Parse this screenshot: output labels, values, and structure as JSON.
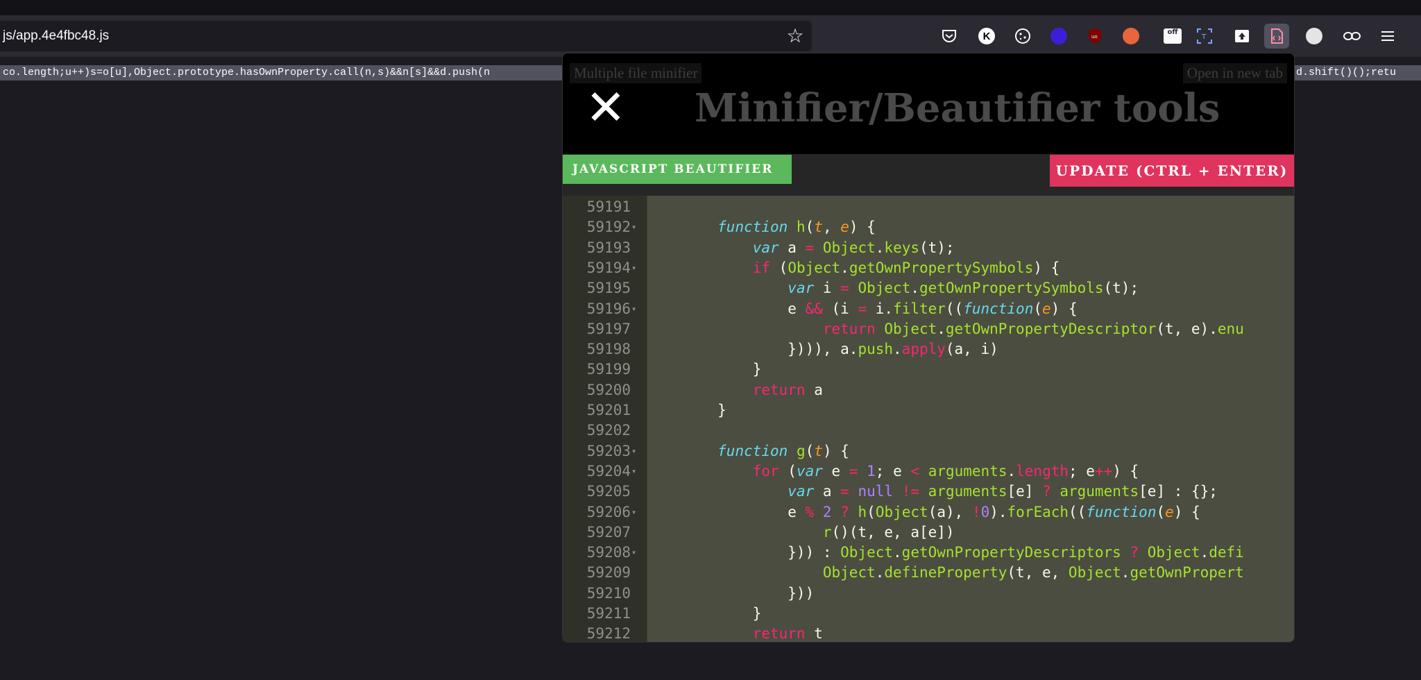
{
  "browser": {
    "url": "js/app.4e4fbc48.js",
    "minified_text_left": "co.length;u++)s=o[u],Object.prototype.hasOwnProperty.call(n,s)&&n[s]&&d.push(n",
    "minified_text_right": "d.shift()();retu",
    "star_icon": "star-icon"
  },
  "extensions": [
    "pocket-icon",
    "k-icon",
    "cookie-icon",
    "circle-icon",
    "ublock-icon",
    "fox-icon",
    "off-icon",
    "scan-icon",
    "upload-icon",
    "minifier-icon",
    "ball-icon",
    "eyes-icon",
    "menu-icon"
  ],
  "panel": {
    "link_left": "Multiple file minifier",
    "link_right": "Open in new tab",
    "close_symbol": "✕",
    "title": "Minifier/Beautifier tools",
    "mode_button": "JAVASCRIPT BEAUTIFIER",
    "update_button": "UPDATE (CTRL + ENTER)"
  },
  "editor": {
    "lines": [
      {
        "n": "59191",
        "fold": false
      },
      {
        "n": "59192",
        "fold": true
      },
      {
        "n": "59193",
        "fold": false
      },
      {
        "n": "59194",
        "fold": true
      },
      {
        "n": "59195",
        "fold": false
      },
      {
        "n": "59196",
        "fold": true
      },
      {
        "n": "59197",
        "fold": false
      },
      {
        "n": "59198",
        "fold": false
      },
      {
        "n": "59199",
        "fold": false
      },
      {
        "n": "59200",
        "fold": false
      },
      {
        "n": "59201",
        "fold": false
      },
      {
        "n": "59202",
        "fold": false
      },
      {
        "n": "59203",
        "fold": true
      },
      {
        "n": "59204",
        "fold": true
      },
      {
        "n": "59205",
        "fold": false
      },
      {
        "n": "59206",
        "fold": true
      },
      {
        "n": "59207",
        "fold": false
      },
      {
        "n": "59208",
        "fold": true
      },
      {
        "n": "59209",
        "fold": false
      },
      {
        "n": "59210",
        "fold": false
      },
      {
        "n": "59211",
        "fold": false
      },
      {
        "n": "59212",
        "fold": false
      }
    ],
    "code": [
      "",
      "        <span class=\"s\">function</span> <span class=\"f\">h</span>(<span class=\"p\">t</span>, <span class=\"p\">e</span>) {",
      "            <span class=\"s\">var</span> a <span class=\"k\">=</span> <span class=\"g\">Object</span>.<span class=\"g\">keys</span>(t);",
      "            <span class=\"k\">if</span> (<span class=\"g\">Object</span>.<span class=\"g\">getOwnPropertySymbols</span>) {",
      "                <span class=\"s\">var</span> i <span class=\"k\">=</span> <span class=\"g\">Object</span>.<span class=\"g\">getOwnPropertySymbols</span>(t);",
      "                e <span class=\"k\">&amp;&amp;</span> (i <span class=\"k\">=</span> i.<span class=\"g\">filter</span>((<span class=\"s\">function</span>(<span class=\"p\">e</span>) {",
      "                    <span class=\"k\">return</span> <span class=\"g\">Object</span>.<span class=\"g\">getOwnPropertyDescriptor</span>(t, e).<span class=\"g\">enu</span>",
      "                }))), a.<span class=\"g\">push</span>.<span class=\"k\">apply</span>(a, i)",
      "            }",
      "            <span class=\"k\">return</span> a",
      "        }",
      "",
      "        <span class=\"s\">function</span> <span class=\"f\">g</span>(<span class=\"p\">t</span>) {",
      "            <span class=\"k\">for</span> (<span class=\"s\">var</span> e <span class=\"k\">=</span> <span class=\"n\">1</span>; e <span class=\"k\">&lt;</span> <span class=\"g\">arguments</span>.<span class=\"k\">length</span>; e<span class=\"k\">++</span>) {",
      "                <span class=\"s\">var</span> a <span class=\"k\">=</span> <span class=\"n\">null</span> <span class=\"k\">!=</span> <span class=\"g\">arguments</span>[e] <span class=\"k\">?</span> <span class=\"g\">arguments</span>[e] : {};",
      "                e <span class=\"k\">%</span> <span class=\"n\">2</span> <span class=\"k\">?</span> <span class=\"g\">h</span>(<span class=\"g\">Object</span>(a), <span class=\"k\">!</span><span class=\"n\">0</span>).<span class=\"g\">forEach</span>((<span class=\"s\">function</span>(<span class=\"p\">e</span>) {",
      "                    <span class=\"g\">r</span>()(t, e, a[e])",
      "                })) : <span class=\"g\">Object</span>.<span class=\"g\">getOwnPropertyDescriptors</span> <span class=\"k\">?</span> <span class=\"g\">Object</span>.<span class=\"g\">defi</span>",
      "                    <span class=\"g\">Object</span>.<span class=\"g\">defineProperty</span>(t, e, <span class=\"g\">Object</span>.<span class=\"g\">getOwnPropert</span>",
      "                }))",
      "            }",
      "            <span class=\"k\">return</span> t"
    ]
  }
}
